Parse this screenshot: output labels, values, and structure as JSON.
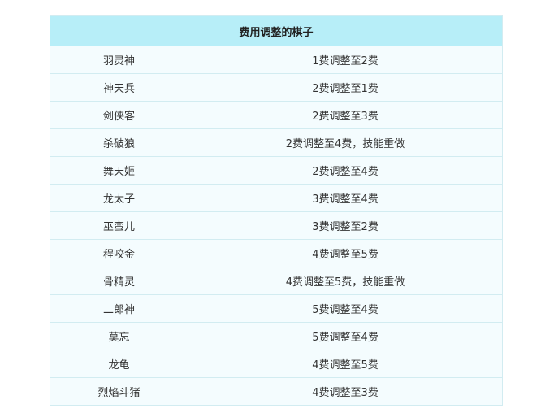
{
  "table": {
    "title": "费用调整的棋子",
    "rows": [
      {
        "name": "羽灵神",
        "change": "1费调整至2费"
      },
      {
        "name": "神天兵",
        "change": "2费调整至1费"
      },
      {
        "name": "剑侠客",
        "change": "2费调整至3费"
      },
      {
        "name": "杀破狼",
        "change": "2费调整至4费，技能重做"
      },
      {
        "name": "舞天姬",
        "change": "2费调整至4费"
      },
      {
        "name": "龙太子",
        "change": "3费调整至4费"
      },
      {
        "name": "巫蛮儿",
        "change": "3费调整至2费"
      },
      {
        "name": "程咬金",
        "change": "4费调整至5费"
      },
      {
        "name": "骨精灵",
        "change": "4费调整至5费，技能重做"
      },
      {
        "name": "二郎神",
        "change": "5费调整至4费"
      },
      {
        "name": "莫忘",
        "change": "5费调整至4费"
      },
      {
        "name": "龙龟",
        "change": "4费调整至5费"
      },
      {
        "name": "烈焰斗猪",
        "change": "4费调整至3费"
      }
    ]
  }
}
